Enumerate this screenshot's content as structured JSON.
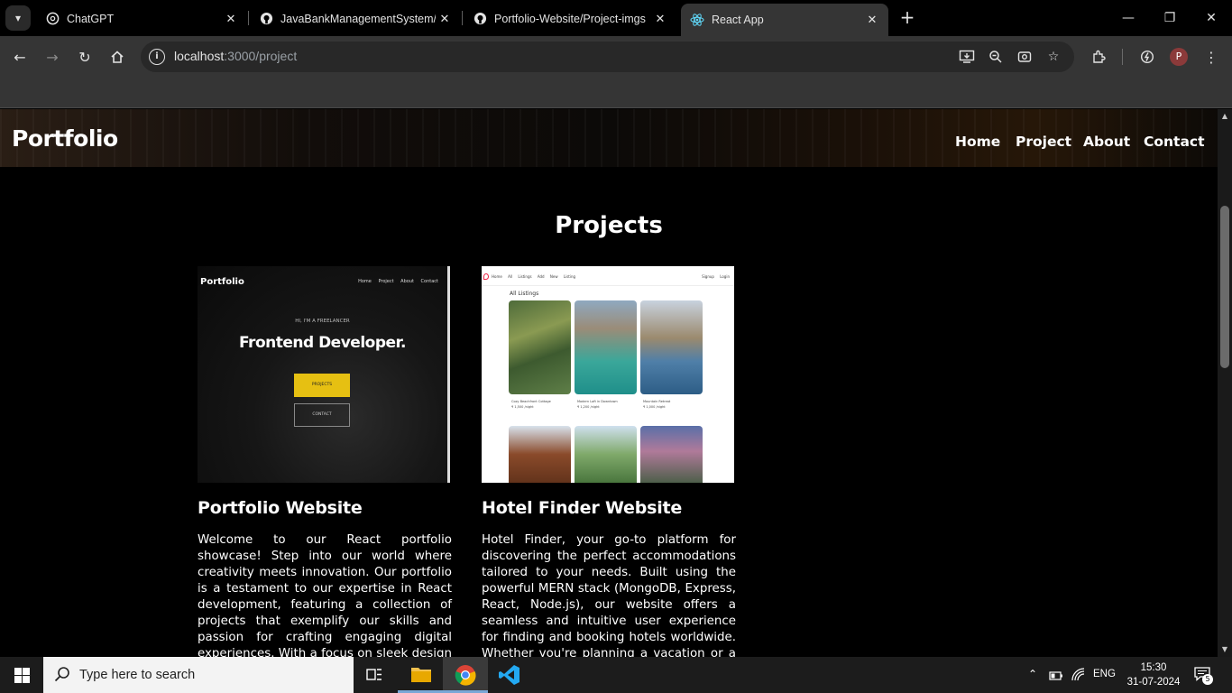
{
  "browser": {
    "tabs": [
      {
        "title": "ChatGPT",
        "icon": "chatgpt-icon",
        "active": false
      },
      {
        "title": "JavaBankManagementSystem/R",
        "icon": "github-icon",
        "active": false
      },
      {
        "title": "Portfolio-Website/Project-imgs",
        "icon": "github-icon",
        "active": false
      },
      {
        "title": "React App",
        "icon": "react-icon",
        "active": true
      }
    ],
    "url_host": "localhost",
    "url_path": ":3000/project",
    "profile_initial": "P"
  },
  "site": {
    "logo": "Portfolio",
    "nav": [
      "Home",
      "Project",
      "About",
      "Contact"
    ],
    "section_title": "Projects"
  },
  "projects": [
    {
      "title": "Portfolio Website",
      "description": "Welcome to our React portfolio showcase! Step into our world where creativity meets innovation. Our portfolio is a testament to our expertise in React development, featuring a collection of projects that exemplify our skills and passion for crafting engaging digital experiences. With a focus on sleek design and seamless functionality, each",
      "preview": {
        "logo": "Portfolio",
        "nav": "Home Project About Contact",
        "tagline": "HI, I'M A FREELANCER",
        "headline": "Frontend Developer.",
        "button_primary": "PROJECTS",
        "button_secondary": "CONTACT"
      }
    },
    {
      "title": "Hotel Finder Website",
      "description": "Hotel Finder, your go-to platform for discovering the perfect accommodations tailored to your needs. Built using the powerful MERN stack (MongoDB, Express, React, Node.js), our website offers a seamless and intuitive user experience for finding and booking hotels worldwide. Whether you're planning a vacation or a business trip, Hotel",
      "preview": {
        "links": "Home All Listings Add New Listing",
        "auth": "Signup Login",
        "heading": "All Listings",
        "captions": [
          {
            "name": "Cozy Beachfront Cottage",
            "price": "₹ 1,500 /night"
          },
          {
            "name": "Modern Loft in Downtown",
            "price": "₹ 1,200 /night"
          },
          {
            "name": "Mountain Retreat",
            "price": "₹ 1,000 /night"
          }
        ]
      }
    }
  ],
  "taskbar": {
    "search_placeholder": "Type here to search",
    "language": "ENG",
    "time": "15:30",
    "date": "31-07-2024",
    "notifications": "5"
  }
}
